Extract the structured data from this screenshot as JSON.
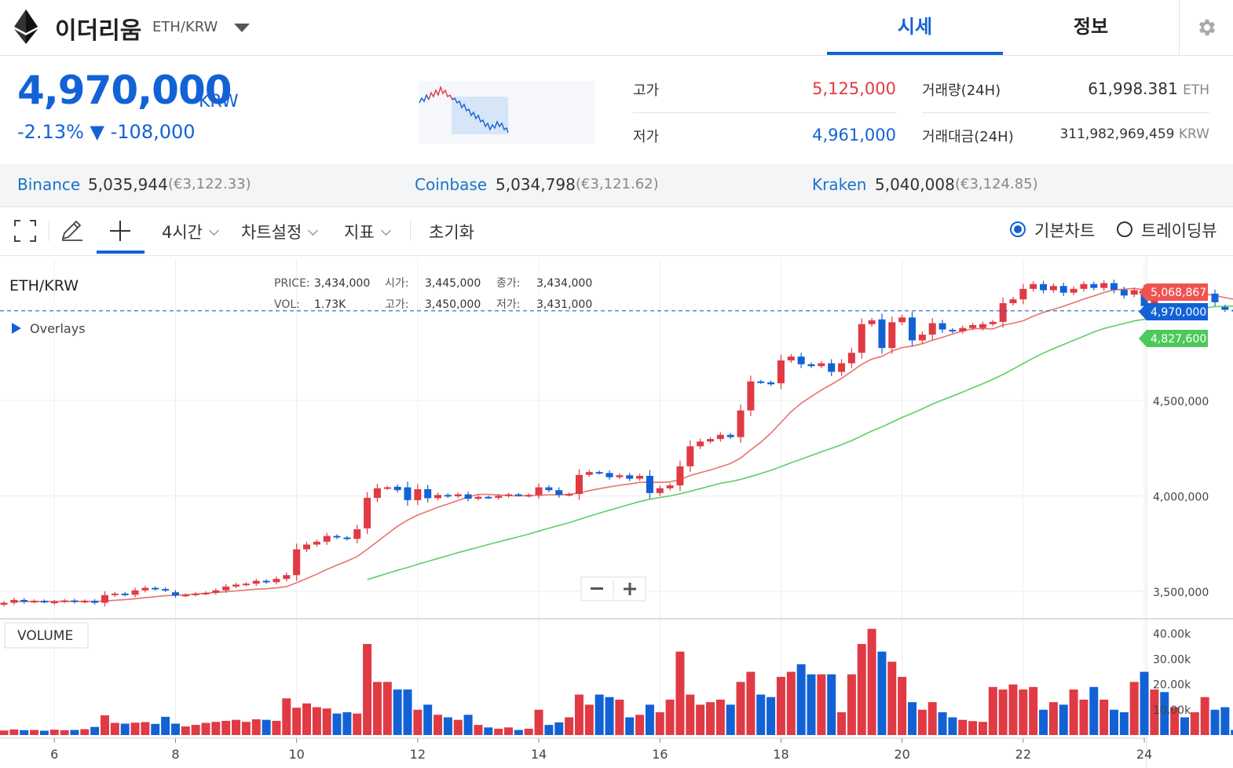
{
  "header": {
    "coin_name": "이더리움",
    "coin_pair": "ETH/KRW",
    "tabs": [
      "시세",
      "정보"
    ]
  },
  "price": {
    "current": "4,970,000",
    "unit": "KRW",
    "change": "-2.13% ▼ -108,000"
  },
  "stats": {
    "high_label": "고가",
    "high_value": "5,125,000",
    "low_label": "저가",
    "low_value": "4,961,000",
    "volume_label": "거래량(24H)",
    "volume_value": "61,998.381",
    "volume_unit": "ETH",
    "amount_label": "거래대금(24H)",
    "amount_value": "311,982,969,459",
    "amount_unit": "KRW"
  },
  "exchanges": [
    {
      "name": "Binance",
      "price": "5,035,944",
      "eur": "(€3,122.33)"
    },
    {
      "name": "Coinbase",
      "price": "5,034,798",
      "eur": "(€3,121.62)"
    },
    {
      "name": "Kraken",
      "price": "5,040,008",
      "eur": "(€3,124.85)"
    }
  ],
  "toolbar": {
    "interval": "4시간",
    "chart_settings": "차트설정",
    "indicators": "지표",
    "reset": "초기화",
    "basic_chart": "기본차트",
    "tradingview": "트레이딩뷰"
  },
  "colors": {
    "accent": "#1262d6",
    "up": "#e03a45",
    "down": "#1262d6",
    "ma_short": "#e8736b",
    "ma_long": "#5fcf63"
  },
  "chart_legend": {
    "pair": "ETH/KRW",
    "price_label": "PRICE:",
    "price": "3,434,000",
    "vol_label": "VOL:",
    "vol": "1.73K",
    "open_label": "시가:",
    "open": "3,445,000",
    "high_label": "고가:",
    "high": "3,450,000",
    "close_label": "종가:",
    "close": "3,434,000",
    "low_label": "저가:",
    "low": "3,431,000",
    "overlays": "Overlays",
    "volume_label": "VOLUME"
  },
  "chart_data": {
    "type": "candlestick",
    "interval": "4시간",
    "y_ticks": [
      3500000,
      4000000,
      4500000
    ],
    "y_tick_labels": [
      "3,500,000",
      "4,000,000",
      "4,500,000"
    ],
    "vol_ticks": [
      10000,
      20000,
      30000,
      40000
    ],
    "vol_tick_labels": [
      "10.00k",
      "20.00k",
      "30.00k",
      "40.00k"
    ],
    "x_tick_labels": [
      "6",
      "8",
      "10",
      "12",
      "14",
      "16",
      "18",
      "20",
      "22",
      "24"
    ],
    "x_ticks_candle_index": [
      5,
      17,
      29,
      41,
      53,
      65,
      77,
      89,
      101,
      113
    ],
    "price_badges": [
      {
        "label": "5,068,867",
        "value": 5068867,
        "color": "#ef5350"
      },
      {
        "label": "4,970,000",
        "value": 4970000,
        "color": "#1262d6"
      },
      {
        "label": "4,827,600",
        "value": 4827600,
        "color": "#4cc95a"
      }
    ],
    "current_price": 4970000,
    "candles": [
      {
        "o": 3430000,
        "c": 3440000,
        "v": 1800
      },
      {
        "o": 3440000,
        "c": 3455000,
        "v": 2200
      },
      {
        "o": 3455000,
        "c": 3445000,
        "v": 1900
      },
      {
        "o": 3445000,
        "c": 3450000,
        "v": 2000
      },
      {
        "o": 3450000,
        "c": 3445000,
        "v": 1700
      },
      {
        "o": 3438000,
        "c": 3446000,
        "v": 2100
      },
      {
        "o": 3446000,
        "c": 3452000,
        "v": 1900
      },
      {
        "o": 3452000,
        "c": 3445000,
        "v": 2000
      },
      {
        "o": 3445000,
        "c": 3450000,
        "v": 2300
      },
      {
        "o": 3450000,
        "c": 3440000,
        "v": 3200
      },
      {
        "o": 3440000,
        "c": 3480000,
        "v": 7800
      },
      {
        "o": 3480000,
        "c": 3488000,
        "v": 4800
      },
      {
        "o": 3488000,
        "c": 3482000,
        "v": 4500
      },
      {
        "o": 3482000,
        "c": 3505000,
        "v": 4900
      },
      {
        "o": 3505000,
        "c": 3518000,
        "v": 5100
      },
      {
        "o": 3518000,
        "c": 3512000,
        "v": 4400
      },
      {
        "o": 3512000,
        "c": 3505000,
        "v": 7200
      },
      {
        "o": 3495000,
        "c": 3478000,
        "v": 4500
      },
      {
        "o": 3478000,
        "c": 3482000,
        "v": 3400
      },
      {
        "o": 3482000,
        "c": 3488000,
        "v": 4000
      },
      {
        "o": 3488000,
        "c": 3492000,
        "v": 4800
      },
      {
        "o": 3492000,
        "c": 3505000,
        "v": 5200
      },
      {
        "o": 3505000,
        "c": 3525000,
        "v": 5600
      },
      {
        "o": 3525000,
        "c": 3535000,
        "v": 6000
      },
      {
        "o": 3535000,
        "c": 3540000,
        "v": 5200
      },
      {
        "o": 3540000,
        "c": 3555000,
        "v": 6200
      },
      {
        "o": 3555000,
        "c": 3548000,
        "v": 6000
      },
      {
        "o": 3548000,
        "c": 3565000,
        "v": 5600
      },
      {
        "o": 3565000,
        "c": 3585000,
        "v": 14500
      },
      {
        "o": 3585000,
        "c": 3720000,
        "v": 10800
      },
      {
        "o": 3720000,
        "c": 3745000,
        "v": 12500
      },
      {
        "o": 3745000,
        "c": 3760000,
        "v": 11000
      },
      {
        "o": 3760000,
        "c": 3790000,
        "v": 10500
      },
      {
        "o": 3790000,
        "c": 3782000,
        "v": 8500
      },
      {
        "o": 3782000,
        "c": 3775000,
        "v": 9000
      },
      {
        "o": 3775000,
        "c": 3825000,
        "v": 8500
      },
      {
        "o": 3830000,
        "c": 3990000,
        "v": 36000
      },
      {
        "o": 3990000,
        "c": 4040000,
        "v": 21000
      },
      {
        "o": 4040000,
        "c": 4045000,
        "v": 21000
      },
      {
        "o": 4048000,
        "c": 4030000,
        "v": 18000
      },
      {
        "o": 4045000,
        "c": 3978000,
        "v": 18000
      },
      {
        "o": 3978000,
        "c": 4035000,
        "v": 10000
      },
      {
        "o": 4035000,
        "c": 3988000,
        "v": 12000
      },
      {
        "o": 3988000,
        "c": 4005000,
        "v": 8000
      },
      {
        "o": 4005000,
        "c": 3998000,
        "v": 7000
      },
      {
        "o": 3998000,
        "c": 4008000,
        "v": 6000
      },
      {
        "o": 4008000,
        "c": 3985000,
        "v": 8000
      },
      {
        "o": 3985000,
        "c": 3995000,
        "v": 4000
      },
      {
        "o": 3995000,
        "c": 3992000,
        "v": 3000
      },
      {
        "o": 3990000,
        "c": 4000000,
        "v": 2500
      },
      {
        "o": 4000000,
        "c": 4008000,
        "v": 3000
      },
      {
        "o": 4008000,
        "c": 4005000,
        "v": 2000
      },
      {
        "o": 4000000,
        "c": 4005000,
        "v": 2500
      },
      {
        "o": 4005000,
        "c": 4045000,
        "v": 10000
      },
      {
        "o": 4045000,
        "c": 4030000,
        "v": 4000
      },
      {
        "o": 4030000,
        "c": 4005000,
        "v": 5000
      },
      {
        "o": 4005000,
        "c": 4010000,
        "v": 7000
      },
      {
        "o": 4010000,
        "c": 4110000,
        "v": 16000
      },
      {
        "o": 4110000,
        "c": 4125000,
        "v": 12000
      },
      {
        "o": 4125000,
        "c": 4120000,
        "v": 16000
      },
      {
        "o": 4120000,
        "c": 4098000,
        "v": 15000
      },
      {
        "o": 4098000,
        "c": 4108000,
        "v": 14000
      },
      {
        "o": 4108000,
        "c": 4090000,
        "v": 7000
      },
      {
        "o": 4090000,
        "c": 4105000,
        "v": 8000
      },
      {
        "o": 4105000,
        "c": 4015000,
        "v": 12000
      },
      {
        "o": 4015000,
        "c": 4040000,
        "v": 9000
      },
      {
        "o": 4040000,
        "c": 4055000,
        "v": 14000
      },
      {
        "o": 4055000,
        "c": 4155000,
        "v": 33000
      },
      {
        "o": 4155000,
        "c": 4260000,
        "v": 16000
      },
      {
        "o": 4260000,
        "c": 4285000,
        "v": 12000
      },
      {
        "o": 4285000,
        "c": 4298000,
        "v": 13000
      },
      {
        "o": 4298000,
        "c": 4320000,
        "v": 14000
      },
      {
        "o": 4320000,
        "c": 4308000,
        "v": 12000
      },
      {
        "o": 4308000,
        "c": 4448000,
        "v": 21000
      },
      {
        "o": 4448000,
        "c": 4600000,
        "v": 25000
      },
      {
        "o": 4600000,
        "c": 4595000,
        "v": 16000
      },
      {
        "o": 4595000,
        "c": 4585000,
        "v": 15000
      },
      {
        "o": 4590000,
        "c": 4710000,
        "v": 23000
      },
      {
        "o": 4710000,
        "c": 4730000,
        "v": 25000
      },
      {
        "o": 4730000,
        "c": 4690000,
        "v": 28000
      },
      {
        "o": 4690000,
        "c": 4680000,
        "v": 24000
      },
      {
        "o": 4680000,
        "c": 4695000,
        "v": 24000
      },
      {
        "o": 4695000,
        "c": 4650000,
        "v": 24000
      },
      {
        "o": 4650000,
        "c": 4695000,
        "v": 9000
      },
      {
        "o": 4695000,
        "c": 4750000,
        "v": 24000
      },
      {
        "o": 4750000,
        "c": 4900000,
        "v": 36000
      },
      {
        "o": 4900000,
        "c": 4920000,
        "v": 42000
      },
      {
        "o": 4925000,
        "c": 4775000,
        "v": 33000
      },
      {
        "o": 4775000,
        "c": 4910000,
        "v": 29000
      },
      {
        "o": 4910000,
        "c": 4935000,
        "v": 23000
      },
      {
        "o": 4935000,
        "c": 4815000,
        "v": 13000
      },
      {
        "o": 4815000,
        "c": 4845000,
        "v": 10000
      },
      {
        "o": 4845000,
        "c": 4905000,
        "v": 13000
      },
      {
        "o": 4905000,
        "c": 4872000,
        "v": 9000
      },
      {
        "o": 4870000,
        "c": 4862000,
        "v": 7000
      },
      {
        "o": 4862000,
        "c": 4880000,
        "v": 6000
      },
      {
        "o": 4880000,
        "c": 4895000,
        "v": 5500
      },
      {
        "o": 4880000,
        "c": 4900000,
        "v": 5200
      },
      {
        "o": 4900000,
        "c": 4912000,
        "v": 19000
      },
      {
        "o": 4912000,
        "c": 5010000,
        "v": 18000
      },
      {
        "o": 5010000,
        "c": 5030000,
        "v": 20000
      },
      {
        "o": 5030000,
        "c": 5085000,
        "v": 18000
      },
      {
        "o": 5085000,
        "c": 5110000,
        "v": 19000
      },
      {
        "o": 5110000,
        "c": 5078000,
        "v": 10000
      },
      {
        "o": 5078000,
        "c": 5100000,
        "v": 13000
      },
      {
        "o": 5100000,
        "c": 5065000,
        "v": 12000
      },
      {
        "o": 5065000,
        "c": 5085000,
        "v": 18000
      },
      {
        "o": 5085000,
        "c": 5110000,
        "v": 14000
      },
      {
        "o": 5110000,
        "c": 5090000,
        "v": 19000
      },
      {
        "o": 5090000,
        "c": 5115000,
        "v": 14000
      },
      {
        "o": 5115000,
        "c": 5080000,
        "v": 10000
      },
      {
        "o": 5080000,
        "c": 5050000,
        "v": 9000
      },
      {
        "o": 5055000,
        "c": 5078000,
        "v": 21000
      },
      {
        "o": 5078000,
        "c": 4995000,
        "v": 25000
      },
      {
        "o": 4995000,
        "c": 5040000,
        "v": 18000
      },
      {
        "o": 5040000,
        "c": 5035000,
        "v": 17000
      },
      {
        "o": 5035000,
        "c": 5045000,
        "v": 11000
      },
      {
        "o": 5045000,
        "c": 5035000,
        "v": 7000
      },
      {
        "o": 5035000,
        "c": 5060000,
        "v": 9000
      },
      {
        "o": 5060000,
        "c": 5060000,
        "v": 15000
      },
      {
        "o": 5060000,
        "c": 5015000,
        "v": 10000
      },
      {
        "o": 4990000,
        "c": 4975000,
        "v": 11000
      },
      {
        "o": 4975000,
        "c": 4970000,
        "v": 2000
      }
    ]
  }
}
